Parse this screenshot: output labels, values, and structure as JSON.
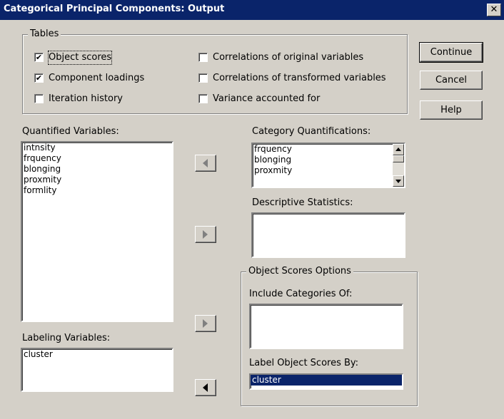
{
  "window": {
    "title": "Categorical Principal Components: Output",
    "close_glyph": "✕"
  },
  "tables_group": {
    "label": "Tables",
    "checkboxes": [
      {
        "label": "Object scores",
        "checked": true
      },
      {
        "label": "Component loadings",
        "checked": true
      },
      {
        "label": "Iteration history",
        "checked": false
      },
      {
        "label": "Correlations of original variables",
        "checked": false
      },
      {
        "label": "Correlations of transformed variables",
        "checked": false
      },
      {
        "label": "Variance accounted for",
        "checked": false
      }
    ]
  },
  "buttons": {
    "continue": "Continue",
    "cancel": "Cancel",
    "help": "Help"
  },
  "quantified_variables": {
    "label": "Quantified Variables:",
    "items": [
      "intnsity",
      "frquency",
      "blonging",
      "proxmity",
      "formlity"
    ]
  },
  "labeling_variables": {
    "label": "Labeling Variables:",
    "items": [
      "cluster"
    ]
  },
  "category_quantifications": {
    "label": "Category Quantifications:",
    "items": [
      "frquency",
      "blonging",
      "proxmity"
    ]
  },
  "descriptive_statistics": {
    "label": "Descriptive Statistics:",
    "items": []
  },
  "object_scores_options": {
    "label": "Object Scores Options",
    "include_categories_label": "Include Categories Of:",
    "include_categories_items": [],
    "label_by_label": "Label Object Scores By:",
    "label_by_items": [
      "cluster"
    ]
  },
  "checkmark": "✔"
}
